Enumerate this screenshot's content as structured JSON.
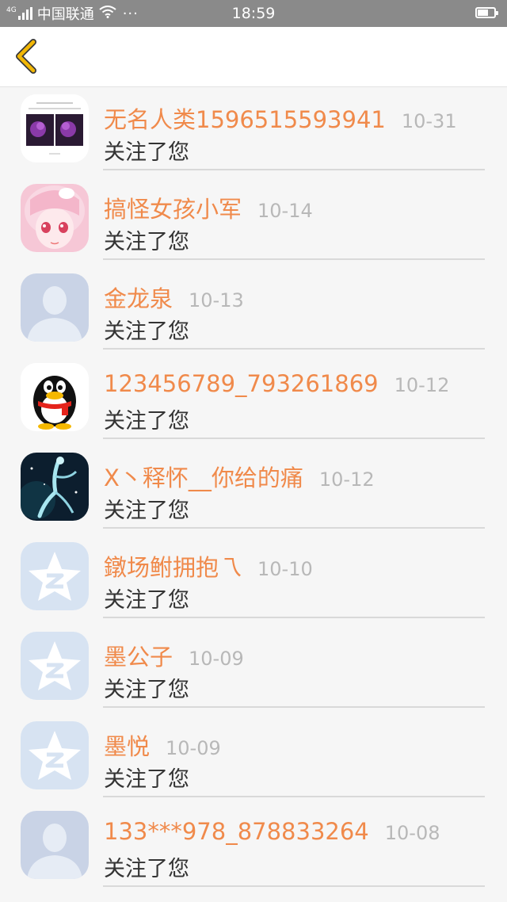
{
  "status_bar": {
    "network_type": "4G",
    "carrier": "中国联通",
    "more": "···",
    "time": "18:59"
  },
  "nav": {
    "back_icon": "chevron-left-icon"
  },
  "items": [
    {
      "name": "无名人类1596515593941",
      "date": "10-31",
      "action": "关注了您",
      "avatar": "thumbnail-image"
    },
    {
      "name": "搞怪女孩小军",
      "date": "10-14",
      "action": "关注了您",
      "avatar": "anime-girl-image"
    },
    {
      "name": "金龙泉",
      "date": "10-13",
      "action": "关注了您",
      "avatar": "default-person-avatar"
    },
    {
      "name": "123456789_793261869",
      "date": "10-12",
      "action": "关注了您",
      "avatar": "qq-penguin-avatar"
    },
    {
      "name": "X丶释怀__你给的痛",
      "date": "10-12",
      "action": "关注了您",
      "avatar": "dancer-image"
    },
    {
      "name": "鐓场鲋拥抱乁",
      "date": "10-10",
      "action": "关注了您",
      "avatar": "qzone-star-avatar"
    },
    {
      "name": "墨公子",
      "date": "10-09",
      "action": "关注了您",
      "avatar": "qzone-star-avatar"
    },
    {
      "name": "墨悦",
      "date": "10-09",
      "action": "关注了您",
      "avatar": "qzone-star-avatar"
    },
    {
      "name": "133***978_878833264",
      "date": "10-08",
      "action": "关注了您",
      "avatar": "default-person-avatar"
    }
  ],
  "colors": {
    "status_bar": "#8a8a8a",
    "name": "#f08a4b",
    "date": "#b8b8b8",
    "action": "#333333",
    "back_icon": "#f2b705"
  }
}
